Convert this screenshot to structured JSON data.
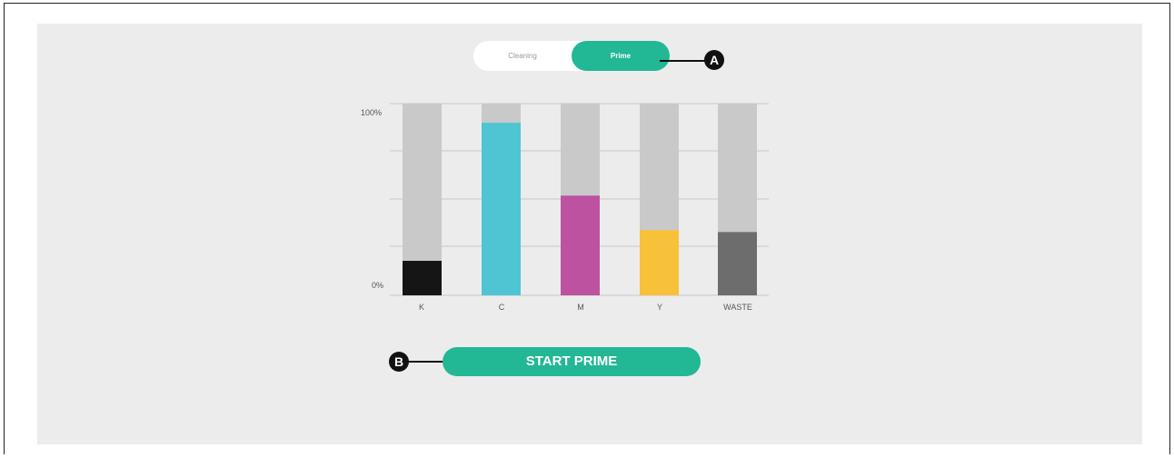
{
  "mode_toggle": {
    "options": [
      "Cleaning",
      "Prime"
    ],
    "selected": "Prime"
  },
  "callouts": {
    "a": "A",
    "b": "B"
  },
  "start_button_label": "START PRIME",
  "chart_data": {
    "type": "bar",
    "categories": [
      "K",
      "C",
      "M",
      "Y",
      "WASTE"
    ],
    "values": [
      18,
      90,
      52,
      34,
      33
    ],
    "colors": [
      "#151515",
      "#4fc5d3",
      "#bd52a0",
      "#f8c13a",
      "#6d6d6d"
    ],
    "track_color": "#c9c9c9",
    "y_tick_labels": [
      "100%",
      "0%"
    ],
    "ylim": [
      0,
      100
    ],
    "grid": true
  }
}
